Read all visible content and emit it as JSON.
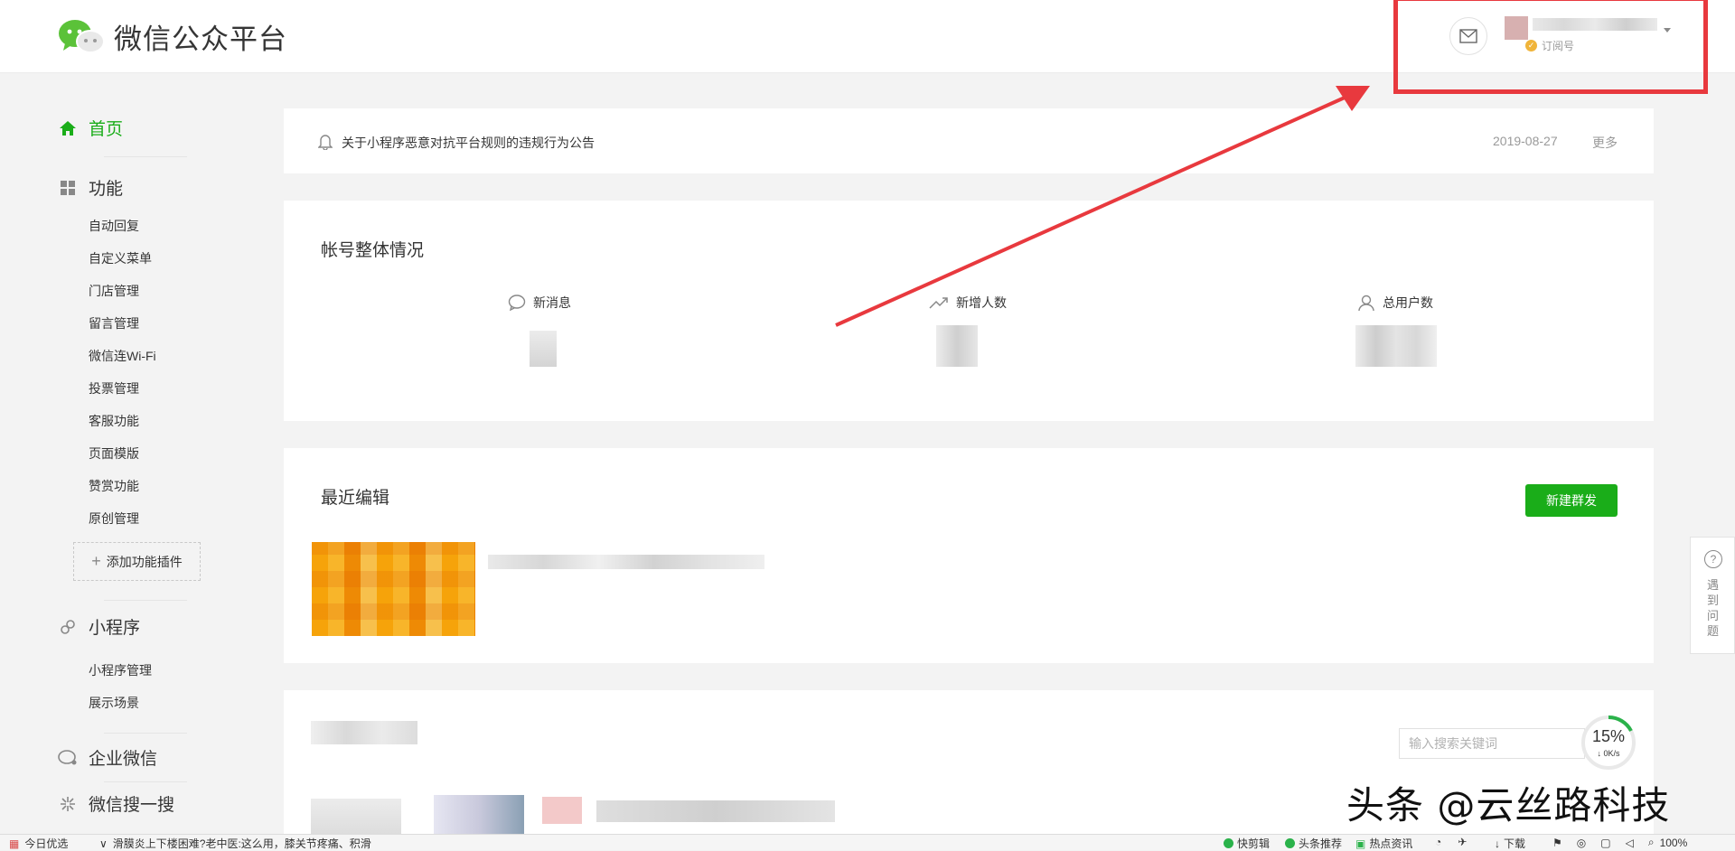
{
  "header": {
    "logo_text": "微信公众平台",
    "account_type": "订阅号"
  },
  "sidebar": {
    "home": "首页",
    "features_title": "功能",
    "features": [
      "自动回复",
      "自定义菜单",
      "门店管理",
      "留言管理",
      "微信连Wi-Fi",
      "投票管理",
      "客服功能",
      "页面模版",
      "赞赏功能",
      "原创管理"
    ],
    "add_plugin": "添加功能插件",
    "miniprogram_title": "小程序",
    "miniprogram": [
      "小程序管理",
      "展示场景"
    ],
    "enterprise": "企业微信",
    "wechat_search": "微信搜一搜"
  },
  "notice": {
    "text": "关于小程序恶意对抗平台规则的违规行为公告",
    "date": "2019-08-27",
    "more": "更多"
  },
  "overview": {
    "title": "帐号整体情况",
    "stats": [
      {
        "label": "新消息",
        "icon": "chat-bubble-icon"
      },
      {
        "label": "新增人数",
        "icon": "trend-up-icon"
      },
      {
        "label": "总用户数",
        "icon": "user-icon"
      }
    ]
  },
  "recent": {
    "title": "最近编辑",
    "new_button": "新建群发"
  },
  "search": {
    "placeholder": "输入搜索关键词"
  },
  "speed": {
    "percent": "15%",
    "rate": "↓ 0K/s"
  },
  "help": {
    "label": "遇到问题"
  },
  "watermark": "头条 @云丝路科技",
  "taskbar": {
    "left_label": "今日优选",
    "news": "滑膜炎上下楼困难?老中医:这么用，膝关节疼痛、积滑",
    "items": [
      "快剪辑",
      "头条推荐",
      "热点资讯",
      "下载"
    ],
    "zoom": "100%"
  },
  "colors": {
    "brand_green": "#1aad19",
    "annotation_red": "#e8393e"
  }
}
